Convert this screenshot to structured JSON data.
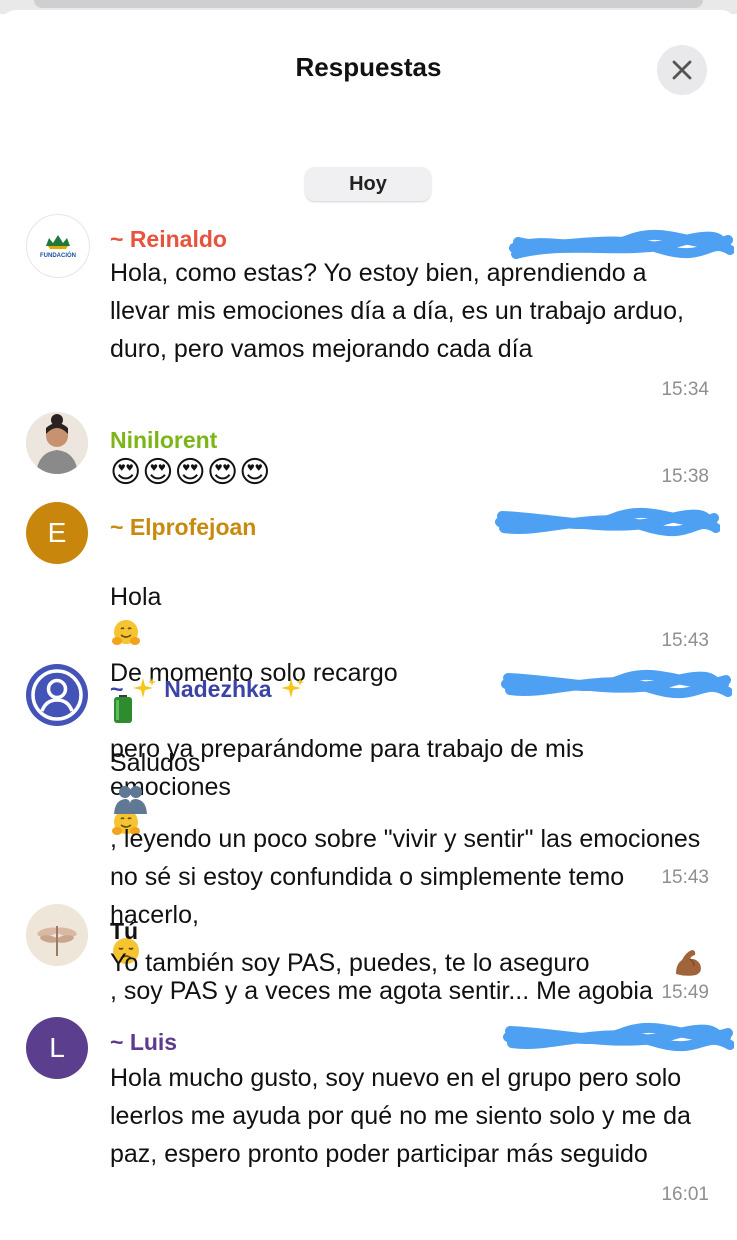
{
  "header": {
    "title": "Respuestas",
    "close_icon": "close-icon"
  },
  "date_separator": "Hoy",
  "messages": [
    {
      "sender": "~ Reinaldo",
      "sender_color": "#e8533e",
      "text": "Hola, como estas? Yo estoy bien, aprendiendo a llevar mis emociones día a día, es un trabajo arduo, duro, pero vamos mejorando cada día",
      "time": "15:34",
      "avatar_text": "FUNDACIÓN"
    },
    {
      "sender": "Ninilorent",
      "sender_color": "#7cb518",
      "emojis": "😍😍😍😍😍",
      "time": "15:38"
    },
    {
      "sender": "~ Elprofejoan",
      "sender_color": "#c88a0c",
      "text_a": "Hola",
      "text_b": "De momento solo recargo",
      "text_c": "pero ya preparándome para trabajo de mis emociones",
      "time": "15:43",
      "avatar_letter": "E",
      "avatar_color": "#c8860d"
    },
    {
      "sender_prefix": "~",
      "sender_name": "Nadezhka",
      "sender_color": "#3b44a6",
      "text_a": "Saludos",
      "text_b": ", leyendo un poco sobre \"vivir y sentir\" las emociones no sé si estoy confundida o simplemente temo hacerlo,",
      "text_c": ", soy PAS y a veces me agota sentir... Me agobia",
      "time": "15:43",
      "avatar_color": "#4453b8"
    },
    {
      "sender": "Tú",
      "sender_color": "#111111",
      "text": "Yo también soy PAS, puedes, te lo aseguro",
      "time": "15:49"
    },
    {
      "sender": "~ Luis",
      "sender_color": "#5c3a8e",
      "text": "Hola mucho gusto, soy nuevo en el grupo pero solo leerlos me ayuda por qué no me siento solo y me da paz, espero pronto poder participar más seguido",
      "time": "16:01",
      "avatar_letter": "L",
      "avatar_color": "#5b3f8e"
    }
  ]
}
